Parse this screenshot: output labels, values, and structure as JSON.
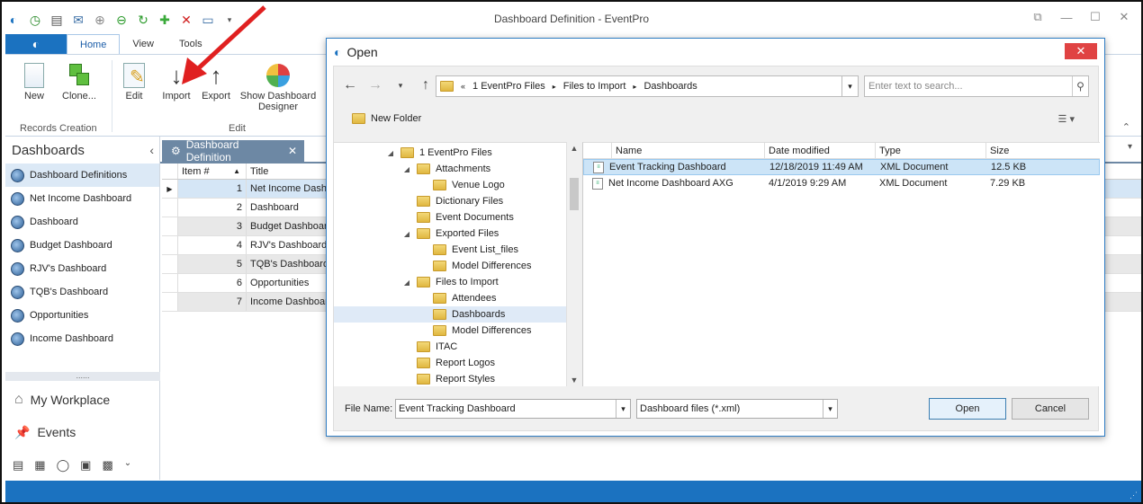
{
  "window": {
    "title": "Dashboard Definition - EventPro"
  },
  "ribbon": {
    "tabs": [
      "Home",
      "View",
      "Tools"
    ],
    "buttons": {
      "new": "New",
      "clone": "Clone...",
      "edit": "Edit",
      "import": "Import",
      "export": "Export",
      "show_designer_1": "Show Dashboard",
      "show_designer_2": "Designer"
    },
    "groups": {
      "records": "Records Creation",
      "edit": "Edit"
    }
  },
  "nav": {
    "header": "Dashboards",
    "items": [
      "Dashboard Definitions",
      "Net Income Dashboard",
      "Dashboard",
      "Budget Dashboard",
      "RJV's Dashboard",
      "TQB's Dashboard",
      "Opportunities",
      "Income Dashboard"
    ],
    "splitter": "......",
    "workplace": "My Workplace",
    "events": "Events"
  },
  "doc": {
    "tab": "Dashboard Definition",
    "columns": {
      "item": "Item #",
      "title": "Title"
    },
    "rows": [
      {
        "n": "1",
        "t": "Net Income Dashb"
      },
      {
        "n": "2",
        "t": "Dashboard"
      },
      {
        "n": "3",
        "t": "Budget Dashboar"
      },
      {
        "n": "4",
        "t": "RJV's Dashboard"
      },
      {
        "n": "5",
        "t": "TQB's Dashboard"
      },
      {
        "n": "6",
        "t": "Opportunities"
      },
      {
        "n": "7",
        "t": "Income Dashboar"
      }
    ]
  },
  "dialog": {
    "title": "Open",
    "path": [
      "1 EventPro Files",
      "Files to Import",
      "Dashboards"
    ],
    "search_placeholder": "Enter text to search...",
    "new_folder": "New Folder",
    "tree": [
      {
        "label": "1 EventPro Files",
        "level": 0,
        "exp": "◢"
      },
      {
        "label": "Attachments",
        "level": 1,
        "exp": "◢"
      },
      {
        "label": "Venue Logo",
        "level": 2,
        "exp": ""
      },
      {
        "label": "Dictionary Files",
        "level": 1,
        "exp": ""
      },
      {
        "label": "Event Documents",
        "level": 1,
        "exp": ""
      },
      {
        "label": "Exported Files",
        "level": 1,
        "exp": "◢"
      },
      {
        "label": "Event List_files",
        "level": 2,
        "exp": ""
      },
      {
        "label": "Model Differences",
        "level": 2,
        "exp": ""
      },
      {
        "label": "Files to Import",
        "level": 1,
        "exp": "◢"
      },
      {
        "label": "Attendees",
        "level": 2,
        "exp": ""
      },
      {
        "label": "Dashboards",
        "level": 2,
        "exp": "",
        "selected": true
      },
      {
        "label": "Model Differences",
        "level": 2,
        "exp": ""
      },
      {
        "label": "ITAC",
        "level": 1,
        "exp": ""
      },
      {
        "label": "Report Logos",
        "level": 1,
        "exp": ""
      },
      {
        "label": "Report Styles",
        "level": 1,
        "exp": ""
      }
    ],
    "columns": {
      "name": "Name",
      "date": "Date modified",
      "type": "Type",
      "size": "Size"
    },
    "files": [
      {
        "name": "Event Tracking Dashboard",
        "date": "12/18/2019 11:49 AM",
        "type": "XML Document",
        "size": "12.5 KB"
      },
      {
        "name": "Net Income Dashboard AXG",
        "date": "4/1/2019 9:29 AM",
        "type": "XML Document",
        "size": "7.29 KB"
      }
    ],
    "file_name_label": "File Name:",
    "file_name_value": "Event Tracking Dashboard",
    "file_type": "Dashboard files (*.xml)",
    "open_button": "Open",
    "cancel_button": "Cancel"
  },
  "colors": {
    "accent": "#1b72c0",
    "doc_tab": "#6d88a4",
    "arrow": "#e02020"
  }
}
